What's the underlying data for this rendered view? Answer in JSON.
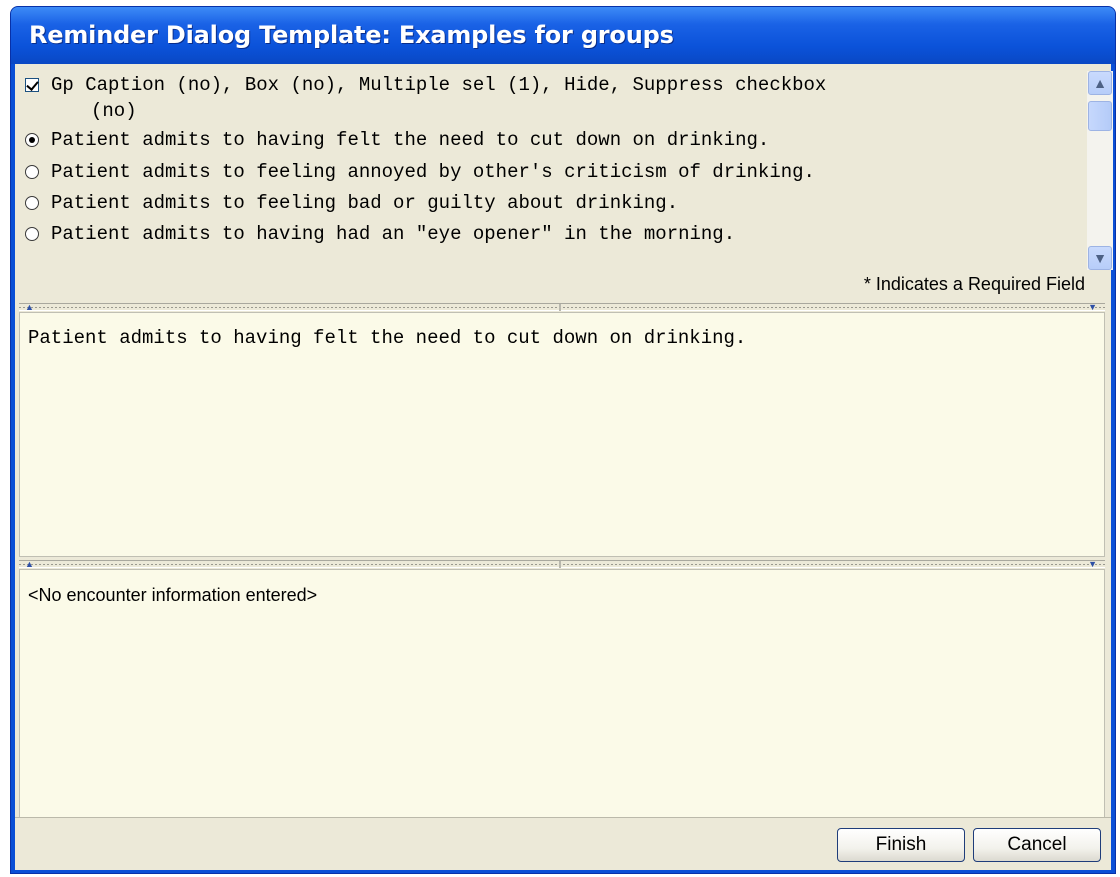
{
  "window": {
    "title": "Reminder Dialog Template: Examples for groups"
  },
  "group": {
    "header_label_line1": "Gp Caption (no), Box (no), Multiple sel (1), Hide, Suppress checkbox",
    "header_label_line2": "(no)",
    "header_checked": true,
    "options": [
      {
        "label": "Patient admits to having felt the need to cut down on drinking.",
        "selected": true
      },
      {
        "label": "Patient admits to feeling annoyed by other's criticism of drinking.",
        "selected": false
      },
      {
        "label": "Patient admits to feeling bad or guilty about drinking.",
        "selected": false
      },
      {
        "label": "Patient admits to having had an \"eye opener\" in the morning.",
        "selected": false
      }
    ],
    "required_note": "* Indicates a Required Field"
  },
  "preview": {
    "text": "Patient admits to having felt the need to cut down on drinking."
  },
  "encounter": {
    "text": "<No encounter information entered>"
  },
  "buttons": {
    "finish": "Finish",
    "cancel": "Cancel"
  },
  "icons": {
    "scroll_up": "scroll-up-arrow-icon",
    "scroll_down": "scroll-down-arrow-icon",
    "splitter_up": "splitter-up-arrow-icon",
    "splitter_down": "splitter-down-arrow-icon"
  },
  "colors": {
    "titlebar": "#0a52d9",
    "dialog_face": "#ece9d8",
    "text_area": "#fbfae8"
  }
}
